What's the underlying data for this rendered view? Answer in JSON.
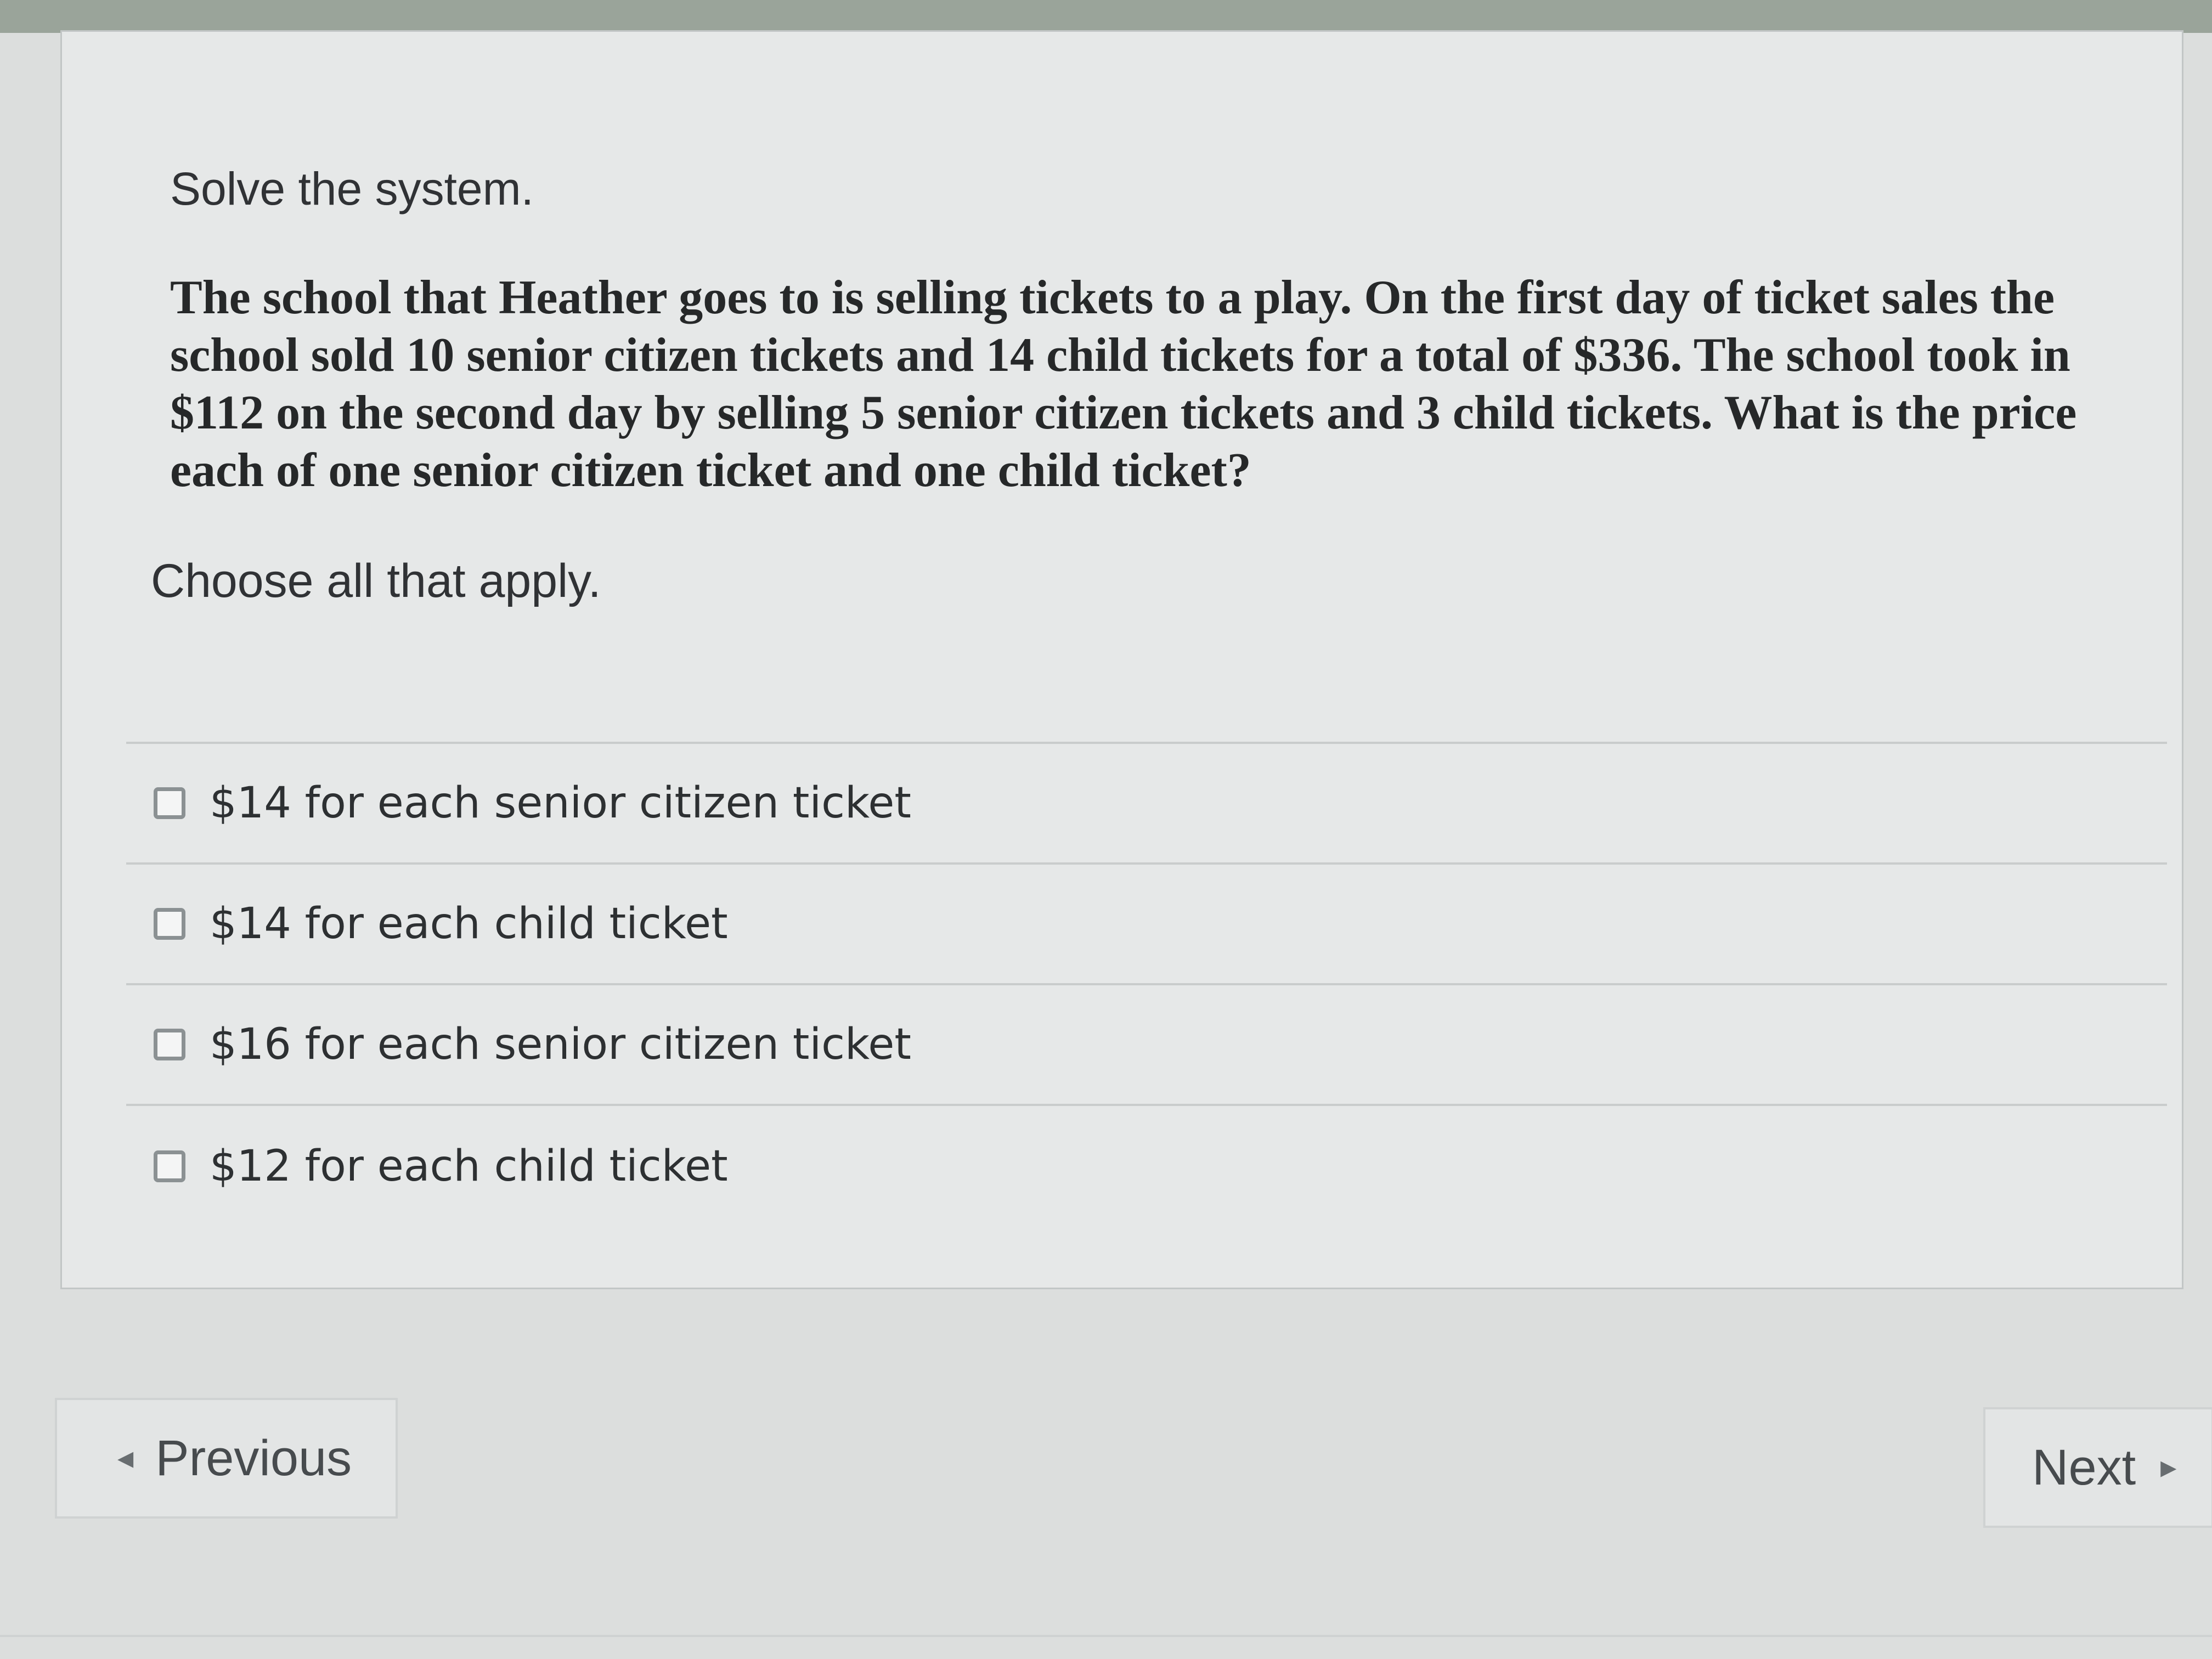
{
  "question": {
    "instruction": "Solve the system.",
    "problem_text": "The school that Heather goes to is selling tickets to a play.  On the first day of ticket sales the school sold 10 senior citizen tickets and 14 child tickets for a total of $336.  The school took in $112 on the second day by selling 5 senior citizen tickets and 3 child tickets.  What is the price each of one senior citizen ticket and one child ticket?",
    "choose_prompt": "Choose all that apply."
  },
  "options": [
    {
      "label": "$14 for each senior citizen ticket",
      "checked": false
    },
    {
      "label": "$14 for each child ticket",
      "checked": false
    },
    {
      "label": "$16 for each senior citizen ticket",
      "checked": false
    },
    {
      "label": "$12 for each child ticket",
      "checked": false
    }
  ],
  "navigation": {
    "previous_label": "Previous",
    "next_label": "Next",
    "previous_icon": "chevron-left-icon",
    "next_icon": "chevron-right-icon"
  }
}
